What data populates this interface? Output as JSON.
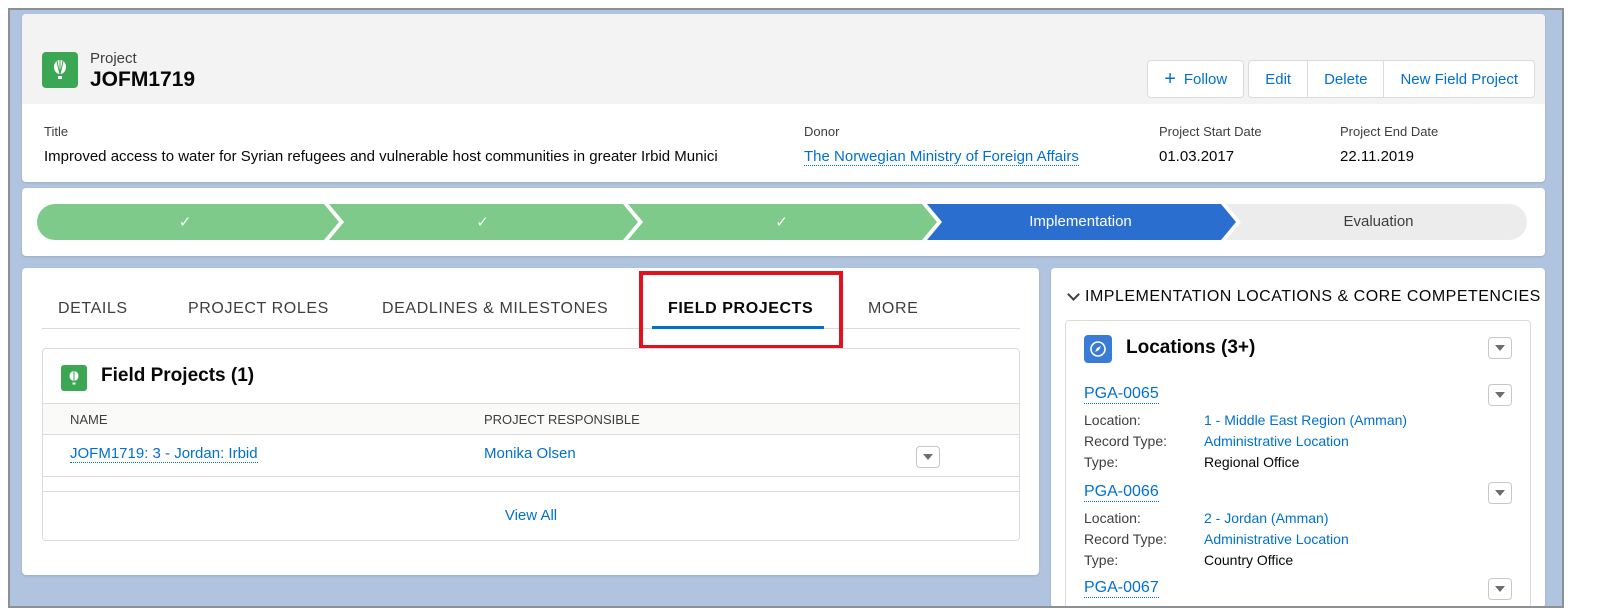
{
  "header": {
    "object_type": "Project",
    "record_name": "JOFM1719",
    "buttons": {
      "follow": "Follow",
      "edit": "Edit",
      "delete": "Delete",
      "new_field_project": "New Field Project"
    },
    "fields": {
      "title_label": "Title",
      "title_value": "Improved access to water for Syrian refugees and vulnerable host communities in greater Irbid Munici",
      "donor_label": "Donor",
      "donor_value": "The Norwegian Ministry of Foreign Affairs",
      "start_label": "Project Start Date",
      "start_value": "01.03.2017",
      "end_label": "Project End Date",
      "end_value": "22.11.2019"
    }
  },
  "path": {
    "stages": [
      {
        "label": "✓",
        "status": "complete"
      },
      {
        "label": "✓",
        "status": "complete"
      },
      {
        "label": "✓",
        "status": "complete"
      },
      {
        "label": "Implementation",
        "status": "current"
      },
      {
        "label": "Evaluation",
        "status": "incomplete"
      }
    ],
    "colors": {
      "complete": "#7dca8a",
      "current": "#2a6fd0",
      "incomplete": "#ececec"
    }
  },
  "tabs": {
    "items": [
      {
        "label": "DETAILS"
      },
      {
        "label": "PROJECT ROLES"
      },
      {
        "label": "DEADLINES & MILESTONES"
      },
      {
        "label": "FIELD PROJECTS"
      },
      {
        "label": "MORE"
      }
    ],
    "active": "FIELD PROJECTS"
  },
  "field_projects": {
    "title": "Field Projects (1)",
    "columns": {
      "name": "NAME",
      "responsible": "PROJECT RESPONSIBLE"
    },
    "rows": [
      {
        "name": "JOFM1719: 3 - Jordan: Irbid",
        "responsible": "Monika Olsen"
      }
    ],
    "view_all": "View All"
  },
  "right_panel": {
    "section_title": "IMPLEMENTATION LOCATIONS & CORE COMPETENCIES",
    "locations_title": "Locations (3+)",
    "labels": {
      "location": "Location:",
      "record_type": "Record Type:",
      "type": "Type:"
    },
    "records": [
      {
        "id": "PGA-0065",
        "location": "1 - Middle East Region (Amman)",
        "record_type": "Administrative Location",
        "type": "Regional Office"
      },
      {
        "id": "PGA-0066",
        "location": "2 - Jordan (Amman)",
        "record_type": "Administrative Location",
        "type": "Country Office"
      },
      {
        "id": "PGA-0067"
      }
    ]
  },
  "colors": {
    "brand": "#0070d2",
    "project_icon": "#3ba755",
    "location_icon": "#3a7cd5",
    "highlight": "#e0121d"
  }
}
